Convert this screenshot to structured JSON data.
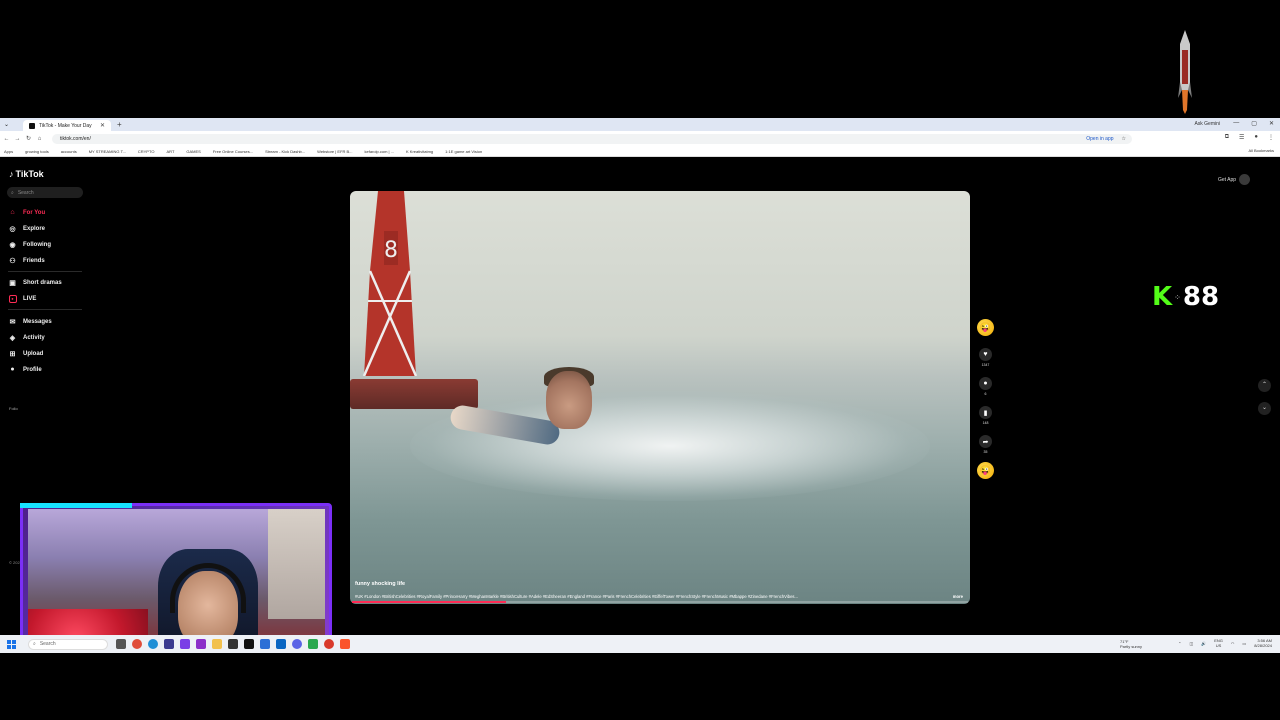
{
  "browser": {
    "tab_title": "TikTok - Make Your Day",
    "new_tab_symbol": "+",
    "ask_gemini": "Ask Gemini",
    "url": "tiktok.com/en/",
    "open_in_app": "Open in app",
    "bookmarks": [
      "Apps",
      "growing tools",
      "accounts",
      "MY STREAMING T...",
      "CRYPTO",
      "ART",
      "GAMES",
      "Free Online Courses...",
      "Stream - Kick Dashb...",
      "Webstore | EFR B...",
      "kefarolp.com | ...",
      "K Kreativitatmg",
      "1:1E game art Vision"
    ],
    "all_bookmarks": "All Bookmarks"
  },
  "tiktok": {
    "logo_text": "TikTok",
    "search_placeholder": "Search",
    "nav": [
      {
        "label": "For You",
        "icon": "home-icon"
      },
      {
        "label": "Explore",
        "icon": "compass-icon"
      },
      {
        "label": "Following",
        "icon": "following-icon"
      },
      {
        "label": "Friends",
        "icon": "friends-icon"
      },
      {
        "label": "Short dramas",
        "icon": "dramas-icon"
      },
      {
        "label": "LIVE",
        "icon": "live-icon"
      },
      {
        "label": "Messages",
        "icon": "messages-icon"
      },
      {
        "label": "Activity",
        "icon": "activity-icon"
      },
      {
        "label": "Upload",
        "icon": "upload-icon"
      },
      {
        "label": "Profile",
        "icon": "profile-icon"
      }
    ],
    "following_label_fragment": "Follo",
    "copyright": "© 2024 TikTok",
    "get_app": "Get App",
    "video": {
      "caption": "funny shocking life",
      "hashtags": "#UK #London #BritishCelebrities #RoyalFamily #PrinceHarry #MeghanMarkle #BritishCulture #Adele #EdSheeran #England #France #Paris #FrenchCelebrities #EiffelTower #FrenchStyle #FrenchMusic #Mbappe #Zinedane #FrenchVibes...",
      "more": "more",
      "progress": 0.25,
      "buoy_number": "8"
    },
    "actions": {
      "likes": "1347",
      "comments": "6",
      "saves": "148",
      "shares": "35"
    }
  },
  "overlay": {
    "k_letter": "K",
    "k_number": "88"
  },
  "taskbar": {
    "search_placeholder": "Search",
    "weather_temp": "71°F",
    "weather_desc": "Partly sunny",
    "lang": "ENG",
    "lang_sub": "US",
    "time": "3:56 AM",
    "date": "8/28/2024"
  },
  "colors": {
    "accent": "#fe2c55",
    "kick_green": "#53fc18",
    "webcam_border": "#7b2ff7"
  }
}
